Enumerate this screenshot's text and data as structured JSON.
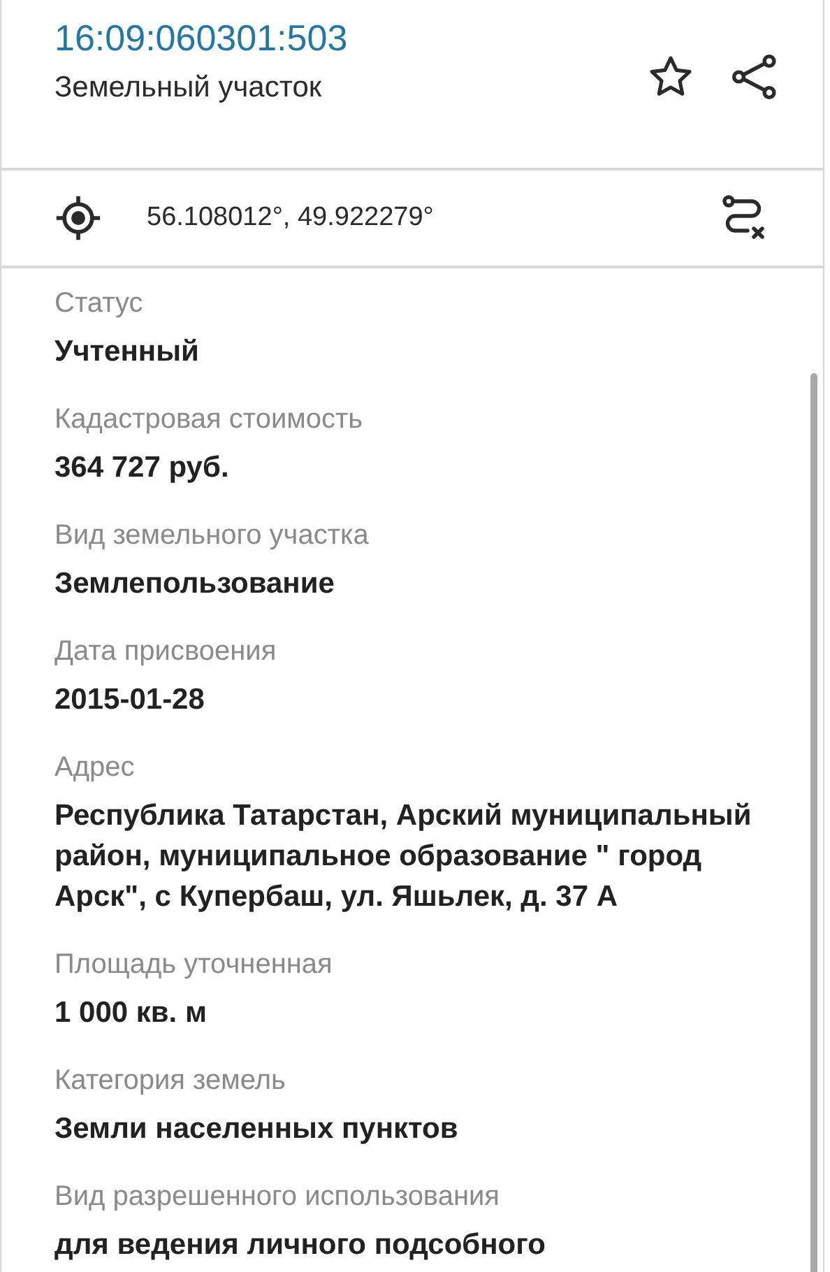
{
  "header": {
    "cadastral_number": "16:09:060301:503",
    "object_type": "Земельный участок"
  },
  "coordinates": {
    "text": "56.108012°, 49.922279°"
  },
  "fields": [
    {
      "label": "Статус",
      "value": "Учтенный"
    },
    {
      "label": "Кадастровая стоимость",
      "value": "364 727 руб."
    },
    {
      "label": "Вид земельного участка",
      "value": "Землепользование"
    },
    {
      "label": "Дата присвоения",
      "value": "2015-01-28"
    },
    {
      "label": "Адрес",
      "value": "Республика Татарстан, Арский муниципальный район, муниципальное образование \" город Арск\", с Купербаш, ул. Яшьлек, д. 37 А"
    },
    {
      "label": "Площадь уточненная",
      "value": "1 000 кв. м"
    },
    {
      "label": "Категория земель",
      "value": "Земли населенных пунктов"
    },
    {
      "label": "Вид разрешенного использования",
      "value": "для ведения личного подсобного"
    }
  ]
}
